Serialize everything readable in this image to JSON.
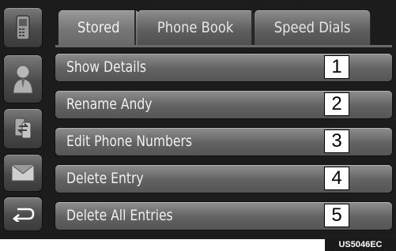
{
  "tabs": [
    {
      "label": "Stored",
      "active": true
    },
    {
      "label": "Phone Book",
      "active": false
    },
    {
      "label": "Speed Dials",
      "active": false
    }
  ],
  "sidebar": {
    "items": [
      {
        "icon": "phone-icon"
      },
      {
        "icon": "contact-icon"
      },
      {
        "icon": "transfer-icon"
      },
      {
        "icon": "message-icon"
      },
      {
        "icon": "back-icon"
      }
    ]
  },
  "menu": {
    "items": [
      {
        "label": "Show Details",
        "number": "1"
      },
      {
        "label": "Rename  Andy",
        "number": "2"
      },
      {
        "label": "Edit Phone Numbers",
        "number": "3"
      },
      {
        "label": "Delete Entry",
        "number": "4"
      },
      {
        "label": "Delete All Entries",
        "number": "5"
      }
    ]
  },
  "caption": "US5046EC"
}
